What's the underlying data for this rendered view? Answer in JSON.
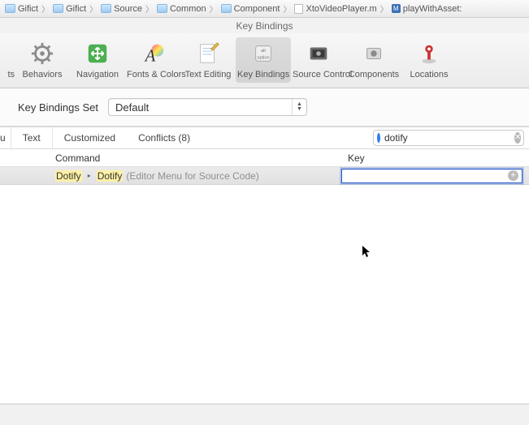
{
  "breadcrumb": [
    {
      "kind": "folder",
      "label": "Gifict"
    },
    {
      "kind": "folder",
      "label": "Gifict"
    },
    {
      "kind": "folder",
      "label": "Source"
    },
    {
      "kind": "folder",
      "label": "Common"
    },
    {
      "kind": "folder",
      "label": "Component"
    },
    {
      "kind": "file",
      "label": "XtoVideoPlayer.m"
    },
    {
      "kind": "symbol",
      "label": "playWithAsset:"
    }
  ],
  "window": {
    "title": "Key Bindings"
  },
  "toolbar": {
    "items_partial_left": {
      "label": "ts"
    },
    "items": [
      {
        "name": "behaviors",
        "label": "Behaviors"
      },
      {
        "name": "navigation",
        "label": "Navigation"
      },
      {
        "name": "fonts-colors",
        "label": "Fonts & Colors"
      },
      {
        "name": "text-editing",
        "label": "Text Editing"
      },
      {
        "name": "key-bindings",
        "label": "Key Bindings",
        "selected": true
      },
      {
        "name": "source-control",
        "label": "Source Control"
      },
      {
        "name": "components",
        "label": "Components"
      },
      {
        "name": "locations",
        "label": "Locations"
      }
    ]
  },
  "settings": {
    "set_label": "Key Bindings Set",
    "set_value": "Default"
  },
  "filters": {
    "partial_left": "u",
    "tabs": [
      {
        "label": "Text"
      },
      {
        "label": "Customized"
      },
      {
        "label": "Conflicts (8)"
      }
    ],
    "search_value": "dotify"
  },
  "table": {
    "headers": {
      "command": "Command",
      "key": "Key"
    },
    "rows": [
      {
        "path1_hl": "Dotify",
        "path2_hl": "Dotify",
        "suffix": "(Editor Menu for Source Code)",
        "key_value": ""
      }
    ]
  }
}
